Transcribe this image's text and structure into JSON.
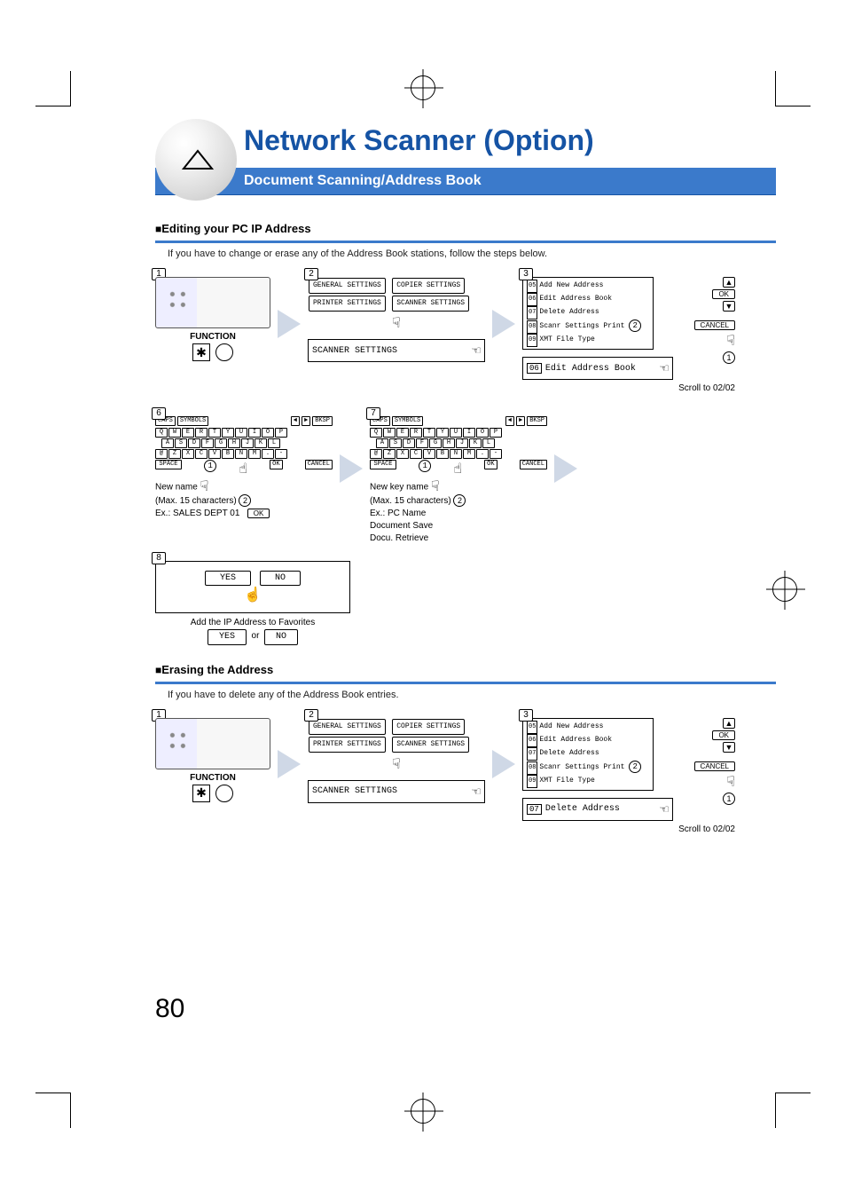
{
  "header": {
    "title": "Network Scanner (Option)",
    "subtitle": "Document Scanning/Address Book"
  },
  "section1": {
    "title": "Editing your PC IP Address",
    "body": "If you have to change or erase any of the Address Book stations, follow the steps below.",
    "function_label": "FUNCTION",
    "scroll": "Scroll to 02/02"
  },
  "lcd_settings": {
    "b1": "GENERAL SETTINGS",
    "b2": "COPIER SETTINGS",
    "b3": "PRINTER SETTINGS",
    "b4": "SCANNER SETTINGS",
    "select": "SCANNER SETTINGS"
  },
  "menu": {
    "items": [
      {
        "n": "05",
        "t": "Add New Address"
      },
      {
        "n": "06",
        "t": "Edit Address Book"
      },
      {
        "n": "07",
        "t": "Delete Address"
      },
      {
        "n": "08",
        "t": "Scanr Settings Print"
      },
      {
        "n": "09",
        "t": "XMT File Type"
      }
    ],
    "ok": "OK",
    "cancel": "CANCEL",
    "sel_edit_n": "06",
    "sel_edit_t": "Edit Address Book",
    "sel_del_n": "07",
    "sel_del_t": "Delete Address"
  },
  "kbd_top": {
    "caps": "CAPS",
    "sym": "SYMBOLS",
    "back": "BKSP",
    "left": "◄",
    "right": "►"
  },
  "kbd_bottom": {
    "spc": "SPACE",
    "ok": "OK",
    "cancel": "CANCEL"
  },
  "step6": {
    "l1": "New name",
    "l2": "(Max. 15 characters)",
    "l3": "Ex.: SALES DEPT 01",
    "ok": "OK"
  },
  "step7": {
    "l1": "New key name",
    "l2": "(Max. 15 characters)",
    "l3": "Ex.: PC Name",
    "l4": "Document Save",
    "l5": "Docu. Retrieve"
  },
  "step8": {
    "yes": "YES",
    "no": "NO",
    "l1": "Add the IP Address to Favorites",
    "or": "or"
  },
  "section2": {
    "title": "Erasing the Address",
    "body": "If you have to delete any of the Address Book entries.",
    "scroll": "Scroll to 02/02"
  },
  "circ": {
    "c1": "1",
    "c2": "2"
  },
  "page_number": "80"
}
